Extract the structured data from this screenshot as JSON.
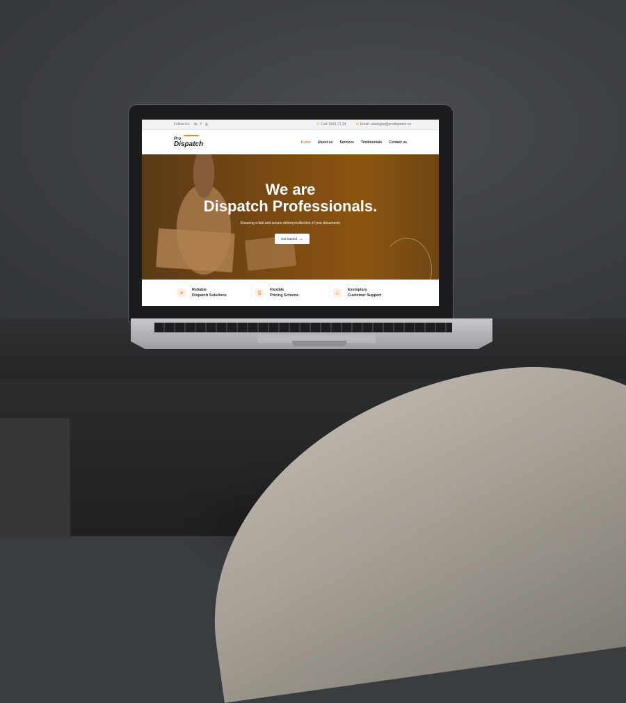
{
  "topbar": {
    "follow_label": "Follow Us:",
    "social_icons": [
      "linkedin-icon",
      "facebook-icon",
      "instagram-icon"
    ],
    "social_glyphs": [
      "in",
      "f",
      "◎"
    ],
    "call_text": "Call: 5941 21 24",
    "email_text": "Email: abakajoe@prodispatch.co"
  },
  "nav": {
    "logo_small": "Pro",
    "logo_main": "Dispatch",
    "menu": [
      {
        "label": "Home",
        "active": true
      },
      {
        "label": "About us",
        "active": false
      },
      {
        "label": "Services",
        "active": false
      },
      {
        "label": "Testimonials",
        "active": false
      },
      {
        "label": "Contact us",
        "active": false
      }
    ]
  },
  "hero": {
    "title_line1": "We are",
    "title_line2": "Dispatch Professionals.",
    "subtitle": "Ensuring a fast and secure delivery/collection of your documents",
    "cta_label": "Get Started",
    "cta_arrow": "→"
  },
  "features": [
    {
      "line1": "Reliable",
      "line2": "Dispatch Solutions",
      "icon": "lightbulb-icon",
      "glyph": "☀"
    },
    {
      "line1": "Flexible",
      "line2": "Pricing Scheme",
      "icon": "coin-icon",
      "glyph": "$"
    },
    {
      "line1": "Exemplary",
      "line2": "Customer Support",
      "icon": "headset-icon",
      "glyph": "☺"
    }
  ],
  "colors": {
    "accent": "#f08a24",
    "hero_bg": "#7a4a12"
  }
}
